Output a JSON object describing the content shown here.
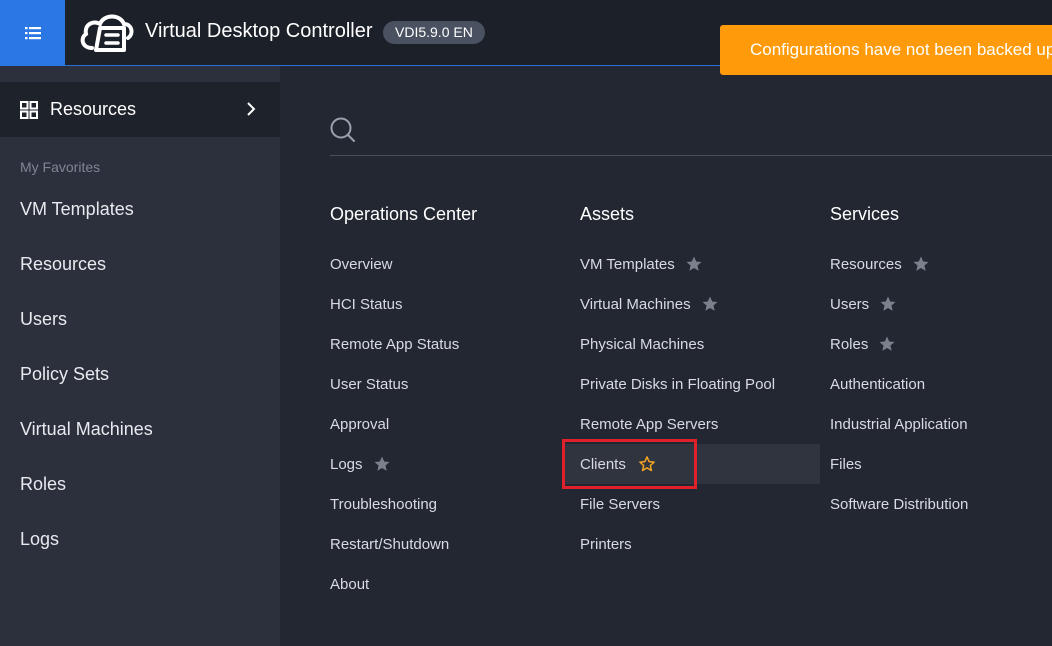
{
  "app": {
    "title": "Virtual Desktop Controller",
    "version": "VDI5.9.0 EN",
    "notice": "Configurations have not been backed up"
  },
  "sidebar": {
    "header_label": "Resources",
    "favorites_heading": "My Favorites",
    "items": [
      "VM Templates",
      "Resources",
      "Users",
      "Policy Sets",
      "Virtual Machines",
      "Roles",
      "Logs"
    ]
  },
  "search": {
    "placeholder": ""
  },
  "menu": {
    "operations_center": {
      "title": "Operations Center",
      "links": [
        "Overview",
        "HCI Status",
        "Remote App Status",
        "User Status",
        "Approval",
        "Logs",
        "Troubleshooting",
        "Restart/Shutdown",
        "About"
      ]
    },
    "assets": {
      "title": "Assets",
      "links": [
        "VM Templates",
        "Virtual Machines",
        "Physical Machines",
        "Private Disks in Floating Pool",
        "Remote App Servers",
        "Clients",
        "File Servers",
        "Printers"
      ]
    },
    "services": {
      "title": "Services",
      "links": [
        "Resources",
        "Users",
        "Roles",
        "Authentication",
        "Industrial Application",
        "Files",
        "Software Distribution"
      ]
    }
  },
  "colors": {
    "accent": "#2b78e4",
    "notice_bg": "#ff9b0a",
    "star_favorited": "#7a808c",
    "star_hover": "#f5a623",
    "highlight": "#e0202a"
  }
}
